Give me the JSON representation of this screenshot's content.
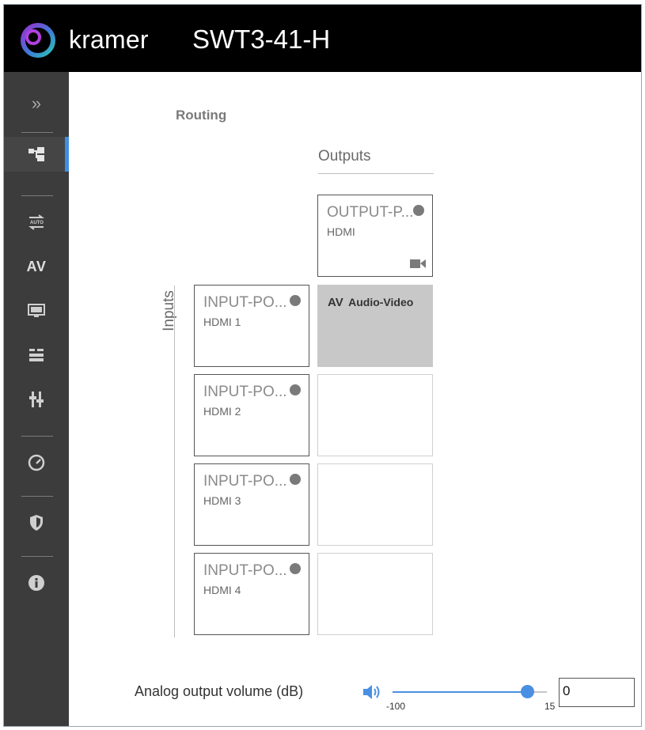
{
  "header": {
    "brand": "kramer",
    "device_name": "SWT3-41-H"
  },
  "sidebar": {
    "items": [
      {
        "icon": "expand-chevrons-icon",
        "label": "»"
      },
      {
        "icon": "routing-icon"
      },
      {
        "icon": "auto-switch-icon"
      },
      {
        "icon": "av-text-icon",
        "label": "AV"
      },
      {
        "icon": "edid-icon"
      },
      {
        "icon": "device-settings-icon"
      },
      {
        "icon": "audio-mixer-icon"
      },
      {
        "icon": "gauge-icon"
      },
      {
        "icon": "security-shield-icon"
      },
      {
        "icon": "info-icon"
      }
    ],
    "active_index": 1
  },
  "routing": {
    "title": "Routing",
    "outputs_label": "Outputs",
    "inputs_label": "Inputs",
    "output": {
      "name": "OUTPUT-P...",
      "type": "HDMI"
    },
    "inputs": [
      {
        "name": "INPUT-PO...",
        "type": "HDMI 1"
      },
      {
        "name": "INPUT-PO...",
        "type": "HDMI 2"
      },
      {
        "name": "INPUT-PO...",
        "type": "HDMI 3"
      },
      {
        "name": "INPUT-PO...",
        "type": "HDMI 4"
      }
    ],
    "route": {
      "input_index": 0,
      "badge": "AV",
      "label": "Audio-Video"
    }
  },
  "volume": {
    "label": "Analog output volume (dB)",
    "min": "-100",
    "max": "15",
    "value": "0"
  },
  "colors": {
    "accent": "#4a90e2",
    "sidebar_bg": "#3c3c3c",
    "header_bg": "#000000",
    "routed_cell": "#c8c8c8"
  }
}
